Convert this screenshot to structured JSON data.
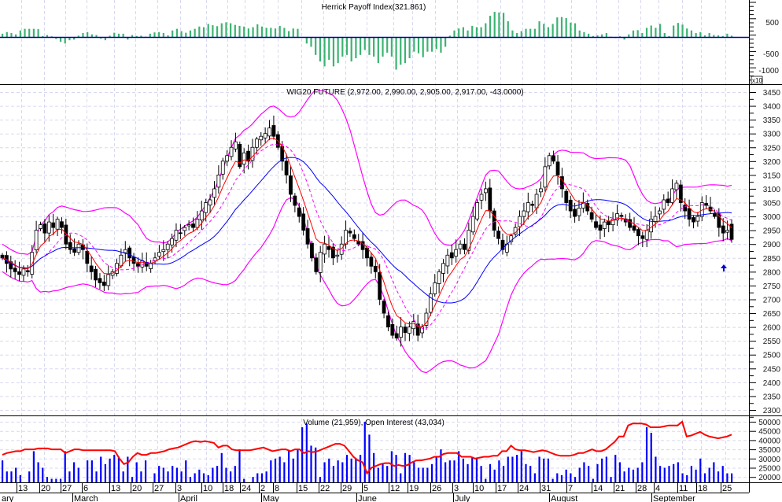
{
  "colors": {
    "candle_up": "#ffffff",
    "candle_down": "#000000",
    "band": "#ff00ff",
    "fast_ma": "#ff0000",
    "slow_ma": "#0000ff",
    "hpi_bar": "#3cb371",
    "volume_bar": "#0000ff",
    "open_interest": "#ff0000",
    "grid": "#d8d8f0",
    "arrow": "#0000cc"
  },
  "chart_data": [
    {
      "type": "bar",
      "title": "Herrick Payoff Index(321.861)",
      "y_ticks": [
        "500",
        "-500",
        "-1000"
      ],
      "y_multiplier_label": "x10",
      "ylim": [
        -1150,
        1200
      ],
      "values": [
        100,
        150,
        120,
        80,
        200,
        250,
        250,
        250,
        240,
        30,
        60,
        20,
        -60,
        -150,
        -200,
        -100,
        -80,
        40,
        120,
        150,
        80,
        60,
        -50,
        -100,
        40,
        130,
        100,
        100,
        -80,
        60,
        30,
        40,
        10,
        100,
        140,
        150,
        120,
        50,
        200,
        250,
        180,
        130,
        200,
        250,
        320,
        300,
        400,
        360,
        330,
        420,
        450,
        420,
        370,
        340,
        320,
        260,
        300,
        390,
        320,
        280,
        280,
        260,
        340,
        280,
        180,
        260,
        250,
        -20,
        -200,
        -300,
        -550,
        -750,
        -900,
        -700,
        -900,
        -800,
        -600,
        -550,
        -750,
        -650,
        -550,
        -400,
        -550,
        -600,
        -800,
        -600,
        -480,
        -600,
        -1000,
        -850,
        -800,
        -650,
        -450,
        -500,
        -620,
        -450,
        -450,
        -370,
        -480,
        -300,
        40,
        200,
        260,
        300,
        200,
        340,
        300,
        300,
        420,
        650,
        770,
        750,
        740,
        480,
        200,
        120,
        180,
        250,
        250,
        250,
        480,
        400,
        300,
        400,
        600,
        610,
        580,
        440,
        420,
        200,
        150,
        100,
        30,
        50,
        80,
        120,
        10,
        -30,
        20,
        -80,
        80,
        200,
        210,
        120,
        280,
        350,
        280,
        400,
        120,
        30,
        350,
        430,
        380,
        260,
        200,
        120,
        150,
        50,
        120,
        60,
        50,
        30,
        100,
        40
      ]
    },
    {
      "type": "candlestick",
      "title": "WIG20 FUTURE (2,972.00, 2,990.00, 2,905.00, 2,917.00, -43.0000)",
      "ylim": [
        2275,
        3475
      ],
      "y_ticks": [
        "3450",
        "3400",
        "3350",
        "3300",
        "3250",
        "3200",
        "3150",
        "3100",
        "3050",
        "3000",
        "2950",
        "2900",
        "2850",
        "2800",
        "2750",
        "2700",
        "2650",
        "2600",
        "2550",
        "2500",
        "2450",
        "2400",
        "2350",
        "2300"
      ],
      "last_bar": {
        "open": 2972,
        "high": 2990,
        "low": 2905,
        "close": 2917,
        "change": -43
      },
      "close": [
        2850,
        2830,
        2810,
        2800,
        2790,
        2810,
        2800,
        2870,
        2950,
        2970,
        2940,
        2980,
        2960,
        2990,
        2960,
        2900,
        2880,
        2870,
        2900,
        2880,
        2830,
        2800,
        2770,
        2760,
        2750,
        2790,
        2800,
        2830,
        2860,
        2880,
        2850,
        2830,
        2820,
        2840,
        2820,
        2830,
        2850,
        2870,
        2880,
        2900,
        2920,
        2950,
        2940,
        2960,
        2970,
        2960,
        2990,
        3020,
        3050,
        3060,
        3100,
        3150,
        3200,
        3220,
        3250,
        3270,
        3180,
        3230,
        3200,
        3250,
        3280,
        3290,
        3300,
        3320,
        3290,
        3250,
        3200,
        3150,
        3080,
        3040,
        3000,
        2950,
        2900,
        2850,
        2800,
        2870,
        2900,
        2880,
        2850,
        2860,
        2900,
        2950,
        2940,
        2920,
        2900,
        2880,
        2850,
        2820,
        2800,
        2700,
        2650,
        2600,
        2570,
        2560,
        2600,
        2580,
        2600,
        2620,
        2570,
        2600,
        2650,
        2720,
        2760,
        2800,
        2830,
        2860,
        2850,
        2880,
        2900,
        2880,
        2950,
        3000,
        3050,
        3080,
        3100,
        3020,
        2950,
        2920,
        2880,
        2900,
        2930,
        2960,
        3000,
        3020,
        3050,
        3040,
        3080,
        3100,
        3180,
        3220,
        3200,
        3150,
        3100,
        3050,
        3020,
        3000,
        3030,
        3050,
        3020,
        2990,
        2960,
        2950,
        2980,
        2970,
        2990,
        3010,
        3000,
        2980,
        2960,
        2950,
        2930,
        2920,
        2950,
        2990,
        3000,
        3020,
        3060,
        3050,
        3100,
        3120,
        3050,
        3020,
        2990,
        2980,
        3000,
        3050,
        3040,
        3020,
        3000,
        2960,
        2940,
        2950,
        2917
      ],
      "overlays": [
        "Bollinger Bands (20, 2)",
        "Moving average (fast)",
        "Moving average (10, dashed)",
        "Moving average (20)"
      ]
    },
    {
      "type": "bar+line",
      "title": "Volume (21,959), Open Interest (43,034)",
      "ylim": [
        16000,
        54000
      ],
      "y_ticks": [
        "50000",
        "45000",
        "40000",
        "35000",
        "30000",
        "25000",
        "20000"
      ],
      "volume": [
        29000,
        23000,
        23000,
        25000,
        21000,
        17000,
        23000,
        34000,
        28000,
        25000,
        20000,
        19000,
        19000,
        19000,
        34000,
        23000,
        28000,
        25000,
        17000,
        29000,
        29000,
        23000,
        31000,
        27000,
        30000,
        32000,
        31000,
        23000,
        31000,
        20000,
        28000,
        23000,
        29000,
        17000,
        22000,
        26000,
        25000,
        23000,
        26000,
        25000,
        23000,
        29000,
        20000,
        22000,
        24000,
        22000,
        21000,
        25000,
        26000,
        33000,
        25000,
        23000,
        26000,
        35000,
        19000,
        17000,
        20000,
        22000,
        22000,
        23000,
        29000,
        30000,
        31000,
        28000,
        34000,
        30000,
        35000,
        47000,
        49000,
        37000,
        36000,
        20000,
        28000,
        30000,
        26000,
        29000,
        28000,
        32000,
        30000,
        30000,
        32000,
        50000,
        43000,
        33000,
        25000,
        27000,
        26000,
        34000,
        32000,
        22000,
        33000,
        32000,
        28000,
        25000,
        25000,
        25000,
        27000,
        31000,
        35000,
        28000,
        29000,
        29000,
        34000,
        30000,
        27000,
        31000,
        30000,
        26000,
        19000,
        27000,
        24000,
        29000,
        26000,
        31000,
        31000,
        32000,
        34000,
        27000,
        26000,
        22000,
        31000,
        30000,
        30000,
        19000,
        22000,
        21000,
        24000,
        22000,
        20000,
        25000,
        28000,
        26000,
        19000,
        27000,
        30000,
        31000,
        20000,
        32000,
        28000,
        23000,
        25000,
        24000,
        25000,
        28000,
        47000,
        44000,
        31000,
        26000,
        25000,
        26000,
        27000,
        28000,
        22000,
        21000,
        26000,
        24000,
        30000,
        22000,
        25000,
        28000,
        23000,
        26000,
        22000,
        21959
      ],
      "open_interest": [
        32000,
        33000,
        33500,
        34000,
        34000,
        35000,
        35000,
        35000,
        35500,
        35500,
        35500,
        35000,
        35000,
        35000,
        33000,
        34000,
        35000,
        35000,
        34500,
        34500,
        34500,
        34500,
        34500,
        34500,
        34500,
        34000,
        30000,
        27000,
        28000,
        31000,
        33000,
        32000,
        32000,
        33000,
        33000,
        33500,
        34000,
        35000,
        35500,
        36000,
        37000,
        38000,
        39000,
        39500,
        39000,
        39500,
        39000,
        38500,
        36000,
        37000,
        37000,
        35000,
        34500,
        34500,
        34500,
        34500,
        35000,
        35500,
        36000,
        35000,
        34000,
        34500,
        35000,
        35000,
        34000,
        35000,
        35000,
        33000,
        34000,
        33500,
        34000,
        35000,
        36000,
        37000,
        38000,
        38000,
        37000,
        34000,
        31000,
        29000,
        28000,
        22000,
        25000,
        26000,
        27000,
        27500,
        27500,
        26000,
        26500,
        26000,
        26500,
        28000,
        29000,
        29000,
        29500,
        30000,
        31000,
        31000,
        32500,
        33000,
        33000,
        33000,
        31000,
        31000,
        31000,
        30000,
        30500,
        31000,
        31000,
        31500,
        31500,
        34000,
        34000,
        37000,
        35000,
        34500,
        34500,
        34000,
        33500,
        34000,
        34500,
        34000,
        33000,
        32000,
        31500,
        31500,
        31500,
        32000,
        33000,
        33000,
        34000,
        35000,
        34000,
        34000,
        35000,
        37000,
        39000,
        42000,
        42000,
        48000,
        49000,
        49000,
        49000,
        48500,
        47000,
        47000,
        47000,
        47500,
        48000,
        48000,
        48000,
        50000,
        42000,
        42500,
        43500,
        44500,
        43000,
        42000,
        41500,
        41000,
        41500,
        42000,
        43034
      ]
    }
  ],
  "x_axis": {
    "dates": [
      "13",
      "20",
      "27",
      "6",
      "13",
      "20",
      "27",
      "3",
      "10",
      "18",
      "24",
      "2",
      "8",
      "15",
      "22",
      "29",
      "5",
      "12",
      "19",
      "26",
      "3",
      "10",
      "17",
      "24",
      "31",
      "7",
      "14",
      "21",
      "28",
      "4",
      "11",
      "18",
      "25"
    ],
    "months": [
      "ary",
      "March",
      "April",
      "May",
      "June",
      "July",
      "August",
      "September"
    ]
  }
}
